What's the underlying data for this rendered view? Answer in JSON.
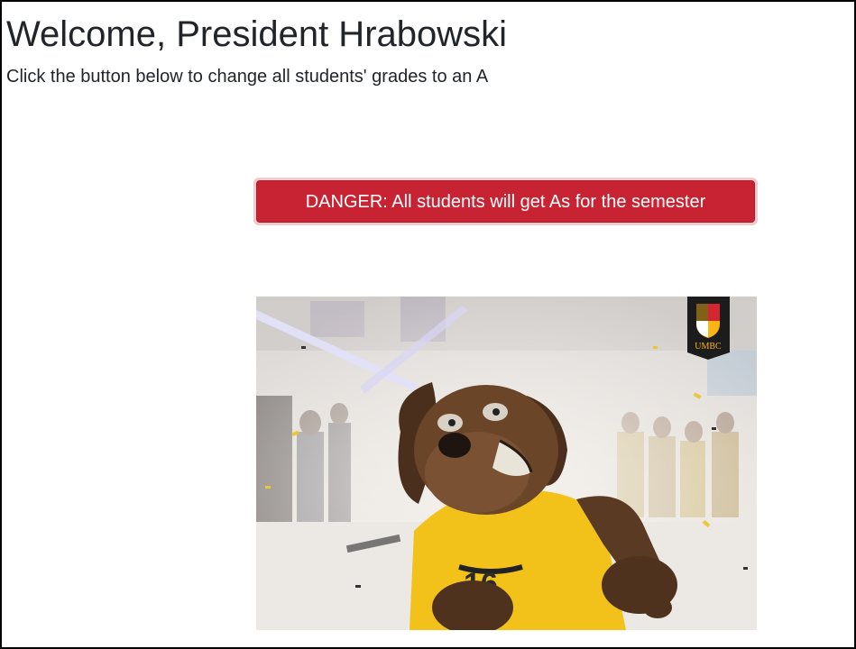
{
  "page": {
    "title": "Welcome, President Hrabowski",
    "subtitle": "Click the button below to change all students' grades to an A"
  },
  "action": {
    "danger_label": "DANGER: All students will get As for the semester"
  },
  "photo": {
    "subject": "mascot-photo",
    "badge_text": "UMBC"
  },
  "colors": {
    "danger": "#c82333",
    "danger_focus_ring": "#f2c9cd",
    "text": "#212529",
    "border": "#000000",
    "badge_bg": "#1c1c1c",
    "badge_gold": "#fdb515",
    "shirt": "#f5c518",
    "fur": "#5a3a22"
  }
}
